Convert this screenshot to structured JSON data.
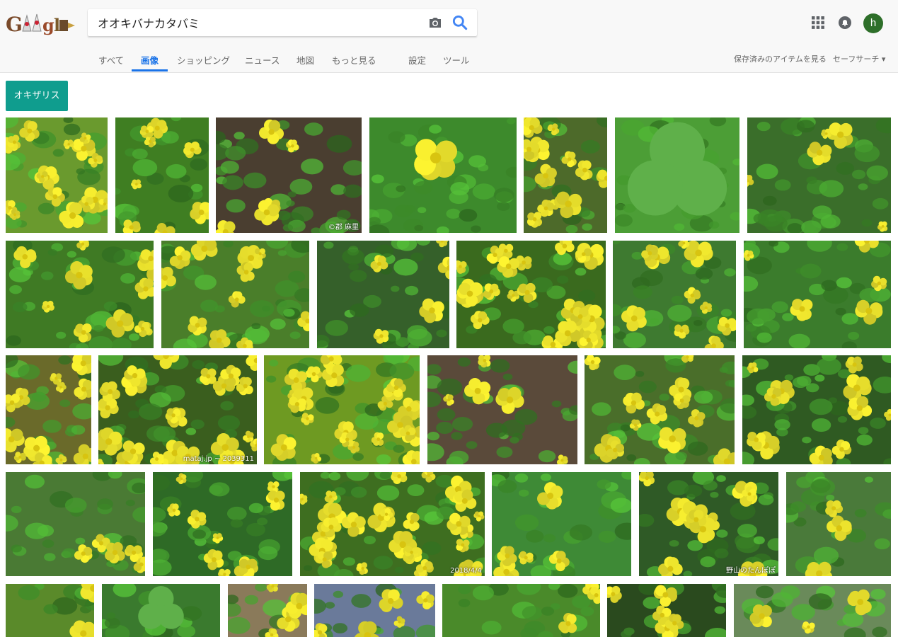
{
  "search": {
    "query": "オオキバナカタバミ"
  },
  "avatar": {
    "initial": "h"
  },
  "tabs": [
    {
      "label": "すべて",
      "active": false
    },
    {
      "label": "画像",
      "active": true
    },
    {
      "label": "ショッピング",
      "active": false
    },
    {
      "label": "ニュース",
      "active": false
    },
    {
      "label": "地図",
      "active": false
    },
    {
      "label": "もっと見る",
      "active": false
    },
    {
      "label": "設定",
      "active": false
    },
    {
      "label": "ツール",
      "active": false
    }
  ],
  "header_links": {
    "saved": "保存済みのアイテムを見る",
    "safesearch": "セーフサーチ ▾"
  },
  "chip": {
    "label": "オキザリス"
  },
  "colors": {
    "accent": "#1a73e8",
    "chip": "#0f9d8e",
    "avatar": "#2e6f2a",
    "flower": "#f2e92e",
    "leaf": "#3f8f2a"
  },
  "watermarks": {
    "r1_3": "©郡 麻里",
    "r3_2": "mataj.jp ~ 2039311",
    "r4_3": "2018/4/4",
    "r4_5": "野山のたんぽぽ"
  },
  "results": [
    {
      "name": "result-image-1",
      "row": 0,
      "bg": "#6a9a2e",
      "flowers": "many"
    },
    {
      "name": "result-image-2",
      "row": 0,
      "bg": "#3f7e22",
      "flowers": "some"
    },
    {
      "name": "result-image-3",
      "row": 0,
      "bg": "#4a3e30",
      "flowers": "few",
      "wm": "r1_3"
    },
    {
      "name": "result-image-4",
      "row": 0,
      "bg": "#3d8a2c",
      "flowers": "one"
    },
    {
      "name": "result-image-5",
      "row": 0,
      "bg": "#4d6a2a",
      "flowers": "many"
    },
    {
      "name": "result-image-6",
      "row": 0,
      "bg": "#4c9e36",
      "flowers": "leaf"
    },
    {
      "name": "result-image-7",
      "row": 0,
      "bg": "#3a6e2a",
      "flowers": "few"
    },
    {
      "name": "result-image-8",
      "row": 1,
      "bg": "#3f7a24",
      "flowers": "some"
    },
    {
      "name": "result-image-9",
      "row": 1,
      "bg": "#4a7e2a",
      "flowers": "some"
    },
    {
      "name": "result-image-10",
      "row": 1,
      "bg": "#35602a",
      "flowers": "few"
    },
    {
      "name": "result-image-11",
      "row": 1,
      "bg": "#3a6a1e",
      "flowers": "many"
    },
    {
      "name": "result-image-12",
      "row": 1,
      "bg": "#3e7a30",
      "flowers": "some"
    },
    {
      "name": "result-image-13",
      "row": 1,
      "bg": "#3b7c2c",
      "flowers": "few"
    },
    {
      "name": "result-image-14",
      "row": 2,
      "bg": "#6a6a2a",
      "flowers": "many"
    },
    {
      "name": "result-image-15",
      "row": 2,
      "bg": "#3a5e1e",
      "flowers": "many",
      "wm": "r3_2"
    },
    {
      "name": "result-image-16",
      "row": 2,
      "bg": "#6e9a22",
      "flowers": "many"
    },
    {
      "name": "result-image-17",
      "row": 2,
      "bg": "#5a4a3a",
      "flowers": "few"
    },
    {
      "name": "result-image-18",
      "row": 2,
      "bg": "#4a6e2a",
      "flowers": "some"
    },
    {
      "name": "result-image-19",
      "row": 2,
      "bg": "#2f5a22",
      "flowers": "some"
    },
    {
      "name": "result-image-20",
      "row": 3,
      "bg": "#4a7a34",
      "flowers": "few"
    },
    {
      "name": "result-image-21",
      "row": 3,
      "bg": "#2e6a26",
      "flowers": "some"
    },
    {
      "name": "result-image-22",
      "row": 3,
      "bg": "#3e6e20",
      "flowers": "many",
      "wm": "r4_3"
    },
    {
      "name": "result-image-23",
      "row": 3,
      "bg": "#3e8a36",
      "flowers": "few"
    },
    {
      "name": "result-image-24",
      "row": 3,
      "bg": "#2f5a26",
      "flowers": "some",
      "wm": "r4_5"
    },
    {
      "name": "result-image-25",
      "row": 3,
      "bg": "#4a7a3a",
      "flowers": "few"
    },
    {
      "name": "result-image-26",
      "row": 4,
      "bg": "#5a8a2a",
      "flowers": "few"
    },
    {
      "name": "result-image-27",
      "row": 4,
      "bg": "#3a7a2e",
      "flowers": "leaf"
    },
    {
      "name": "result-image-28",
      "row": 4,
      "bg": "#8a7a5a",
      "flowers": "some"
    },
    {
      "name": "result-image-29",
      "row": 4,
      "bg": "#6a7a9a",
      "flowers": "some"
    },
    {
      "name": "result-image-30",
      "row": 4,
      "bg": "#4a8a2a",
      "flowers": "few"
    },
    {
      "name": "result-image-31",
      "row": 4,
      "bg": "#2a4a1e",
      "flowers": "some"
    },
    {
      "name": "result-image-32",
      "row": 4,
      "bg": "#6a8a5a",
      "flowers": "few"
    }
  ]
}
